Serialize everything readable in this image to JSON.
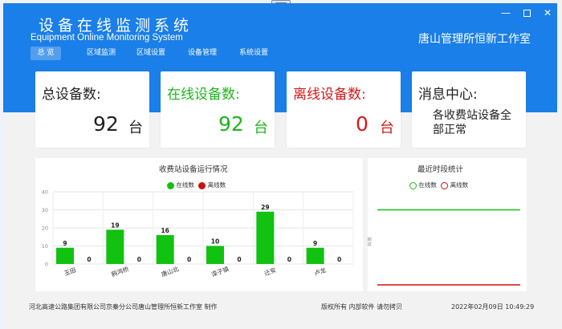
{
  "app": {
    "title_cn": "设备在线监测系统",
    "title_en": "Equipment Online Monitoring System",
    "studio": "唐山管理所恒新工作室"
  },
  "window_buttons": {
    "minimize": "—",
    "maximize": "□",
    "close": "✕"
  },
  "nav": [
    {
      "label": "总  览",
      "active": true
    },
    {
      "label": "区域监测",
      "active": false
    },
    {
      "label": "区域设置",
      "active": false
    },
    {
      "label": "设备管理",
      "active": false
    },
    {
      "label": "系统设置",
      "active": false
    }
  ],
  "cards": {
    "total": {
      "label": "总设备数:",
      "value": "92",
      "unit": "台",
      "color": "#222222"
    },
    "online": {
      "label": "在线设备数:",
      "value": "92",
      "unit": "台",
      "color": "#1fb51f"
    },
    "offline": {
      "label": "离线设备数:",
      "value": "0",
      "unit": "台",
      "color": "#d21a1a"
    },
    "message": {
      "label": "消息中心:",
      "text": "各收费站设备全部正常"
    }
  },
  "colors": {
    "header": "#1a7fe8",
    "online": "#11c211",
    "offline": "#cc1111"
  },
  "chart_data": [
    {
      "type": "bar",
      "title": "收费站设备运行情况",
      "categories": [
        "玉田",
        "鸦鸿桥",
        "唐山北",
        "滦子镇",
        "迁安",
        "卢龙"
      ],
      "series": [
        {
          "name": "在线数",
          "values": [
            9,
            19,
            16,
            10,
            29,
            9
          ]
        },
        {
          "name": "离线数",
          "values": [
            0,
            0,
            0,
            0,
            0,
            0
          ]
        }
      ],
      "ylim": [
        0,
        40
      ],
      "yticks": [
        0,
        10,
        20,
        30,
        40
      ],
      "legend": "top-center",
      "grid": true
    },
    {
      "type": "line",
      "title": "最近时段统计",
      "ylabel": "数量",
      "series": [
        {
          "name": "在线数",
          "values": [
            92,
            92,
            92,
            92,
            92,
            92,
            92,
            92,
            92,
            92
          ]
        },
        {
          "name": "离线数",
          "values": [
            0,
            0,
            0,
            0,
            0,
            0,
            0,
            0,
            0,
            0
          ]
        }
      ],
      "legend": "top-center"
    }
  ],
  "footer": {
    "left": "河北高速公路集团有限公司京秦分公司唐山管理所恒新工作室 制作",
    "middle": "版权所有 内部软件 请勿拷贝",
    "datetime": "2022年02月09日  10:49:29"
  }
}
